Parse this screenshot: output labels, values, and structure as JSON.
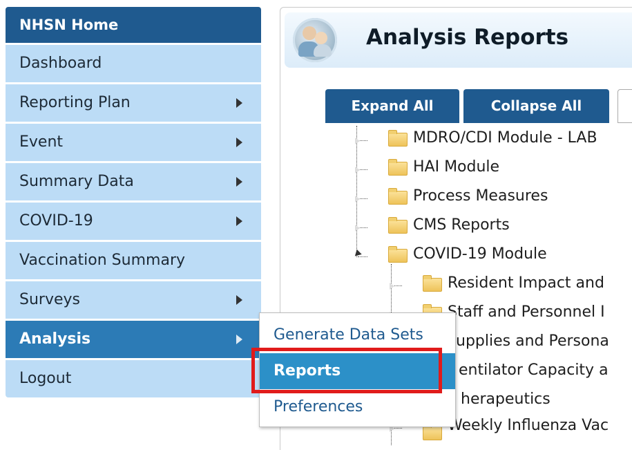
{
  "nav": {
    "home": "NHSN Home",
    "items": [
      {
        "label": "Dashboard",
        "submenu": false
      },
      {
        "label": "Reporting Plan",
        "submenu": true
      },
      {
        "label": "Event",
        "submenu": true
      },
      {
        "label": "Summary Data",
        "submenu": true
      },
      {
        "label": "COVID-19",
        "submenu": true
      },
      {
        "label": "Vaccination Summary",
        "submenu": false
      },
      {
        "label": "Surveys",
        "submenu": true
      },
      {
        "label": "Analysis",
        "submenu": true,
        "active": true
      },
      {
        "label": "Logout",
        "submenu": false
      }
    ]
  },
  "page": {
    "title": "Analysis Reports",
    "expand_all": "Expand All",
    "collapse_all": "Collapse All"
  },
  "tree": [
    {
      "label": "MDRO/CDI Module - LAB",
      "level": 0
    },
    {
      "label": "HAI Module",
      "level": 0
    },
    {
      "label": "Process Measures",
      "level": 0
    },
    {
      "label": "CMS Reports",
      "level": 0
    },
    {
      "label": "COVID-19 Module",
      "level": 0,
      "expanded": true
    },
    {
      "label": "Resident Impact and",
      "level": 1
    },
    {
      "label": "Staff and Personnel I",
      "level": 1
    },
    {
      "label": "upplies and Persona",
      "level": 1
    },
    {
      "label": "entilator Capacity a",
      "level": 1
    },
    {
      "label": "herapeutics",
      "level": 1
    },
    {
      "label": "Weekly Influenza Vac",
      "level": 1
    }
  ],
  "popup": {
    "items": [
      {
        "label": "Generate Data Sets"
      },
      {
        "label": "Reports",
        "highlighted": true
      },
      {
        "label": "Preferences"
      }
    ]
  },
  "colors": {
    "nav_dark": "#1f5a8f",
    "nav_light": "#bcdcf6",
    "nav_active": "#2c7bb6",
    "menu_highlight": "#2c90c8",
    "callout_red": "#e01b1b"
  }
}
